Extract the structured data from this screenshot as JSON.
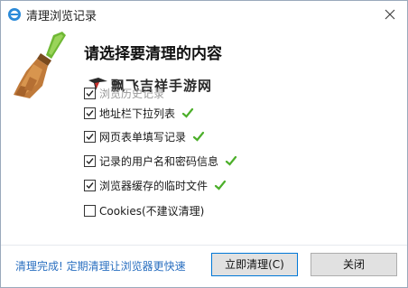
{
  "window": {
    "title": "清理浏览记录"
  },
  "dialog": {
    "heading": "请选择要清理的内容",
    "watermark": "飘飞吉祥手游网"
  },
  "options": [
    {
      "label": "浏览历史记录",
      "checked": true
    },
    {
      "label": "地址栏下拉列表",
      "checked": true
    },
    {
      "label": "网页表单填写记录",
      "checked": true
    },
    {
      "label": "记录的用户名和密码信息",
      "checked": true
    },
    {
      "label": "浏览器缓存的临时文件",
      "checked": true
    },
    {
      "label": "Cookies(不建议清理)",
      "checked": false
    }
  ],
  "footer": {
    "status_link": "清理完成! 定期清理让浏览器更快速",
    "clean_button": "立即清理(C)",
    "close_button": "关闭"
  },
  "colors": {
    "accent": "#2a6fc0",
    "check_green": "#4caf2a",
    "button_bg": "#e1e1e1",
    "button_focus_border": "#0078d7"
  }
}
